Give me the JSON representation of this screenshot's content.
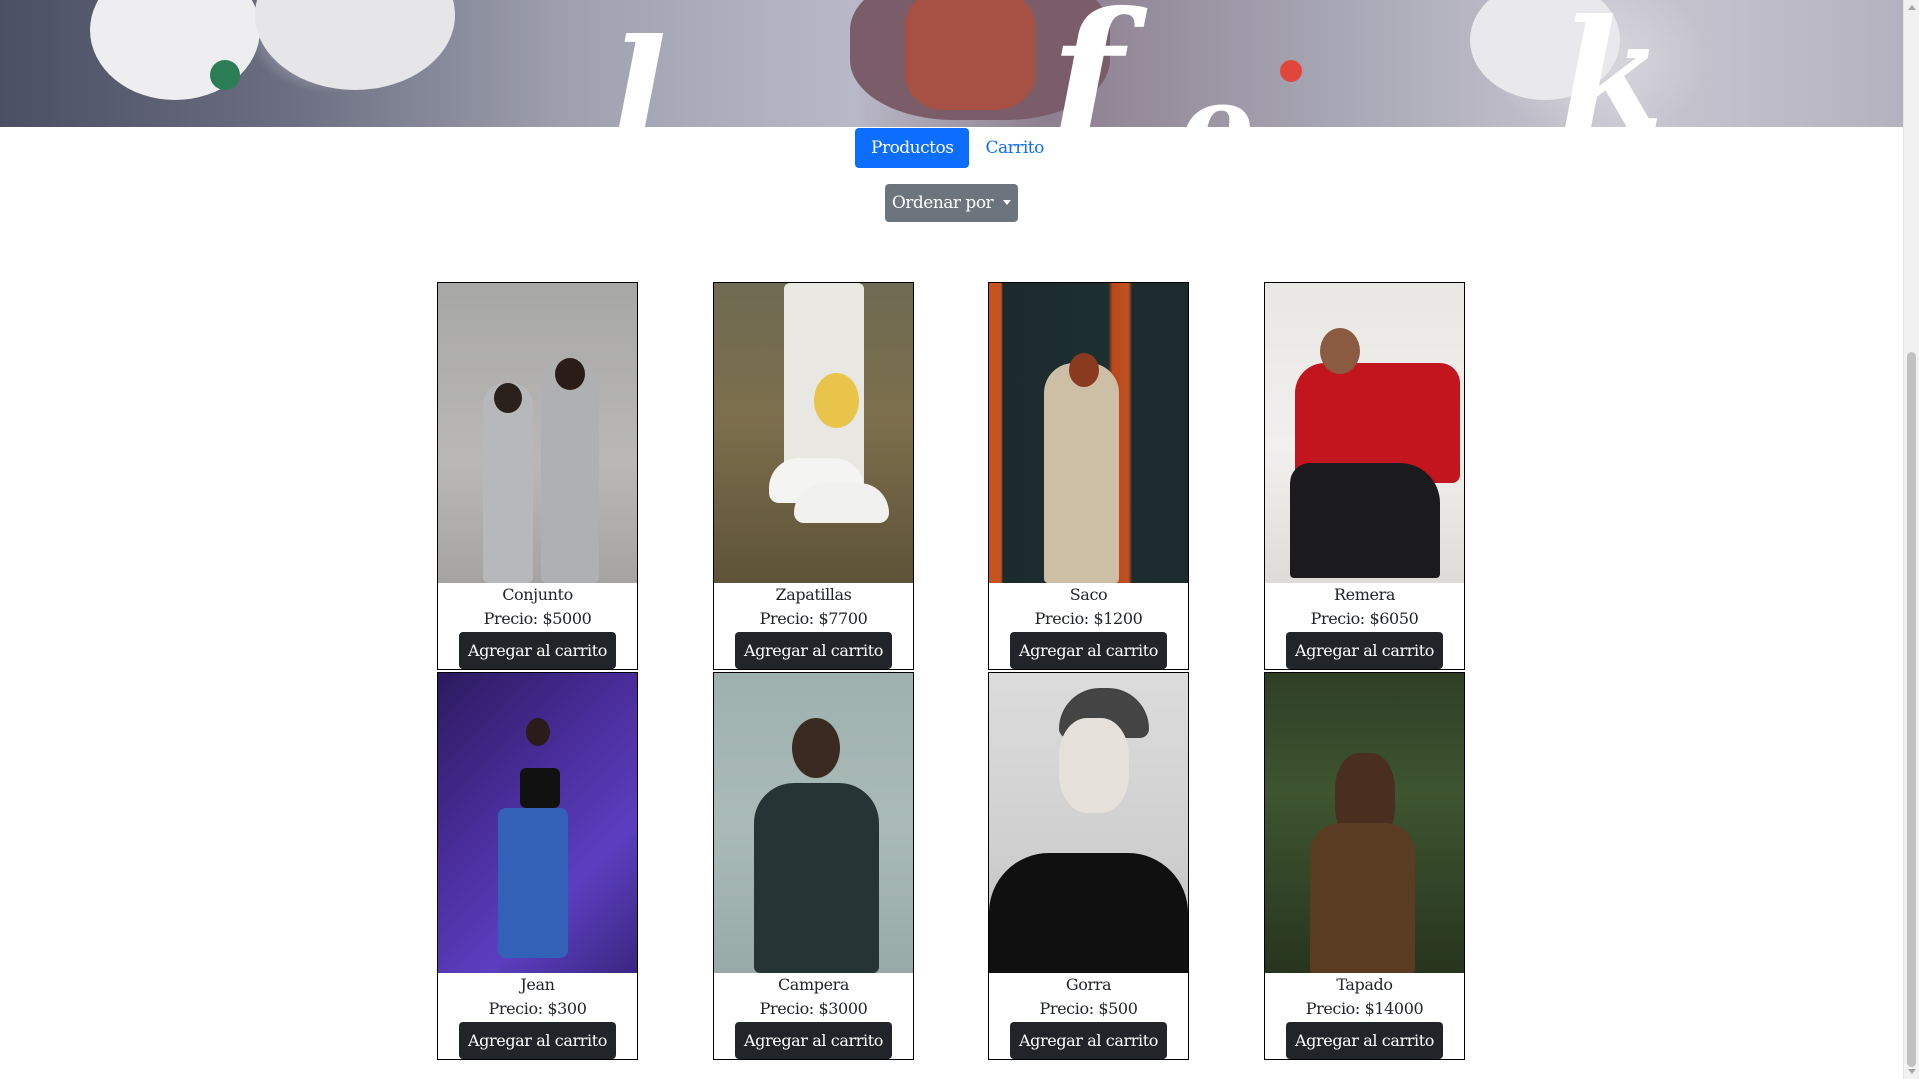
{
  "nav": {
    "tabs": [
      {
        "label": "Productos",
        "active": true
      },
      {
        "label": "Carrito",
        "active": false
      }
    ]
  },
  "sort": {
    "label": "Ordenar por"
  },
  "products": [
    {
      "name": "Conjunto",
      "price": "Precio: $5000",
      "button": "Agregar al carrito"
    },
    {
      "name": "Zapatillas",
      "price": "Precio: $7700",
      "button": "Agregar al carrito"
    },
    {
      "name": "Saco",
      "price": "Precio: $1200",
      "button": "Agregar al carrito"
    },
    {
      "name": "Remera",
      "price": "Precio: $6050",
      "button": "Agregar al carrito"
    },
    {
      "name": "Jean",
      "price": "Precio: $300",
      "button": "Agregar al carrito"
    },
    {
      "name": "Campera",
      "price": "Precio: $3000",
      "button": "Agregar al carrito"
    },
    {
      "name": "Gorra",
      "price": "Precio: $500",
      "button": "Agregar al carrito"
    },
    {
      "name": "Tapado",
      "price": "Precio: $14000",
      "button": "Agregar al carrito"
    }
  ],
  "colors": {
    "primary": "#0d6efd",
    "secondary": "#6c757d",
    "dark": "#212529"
  }
}
